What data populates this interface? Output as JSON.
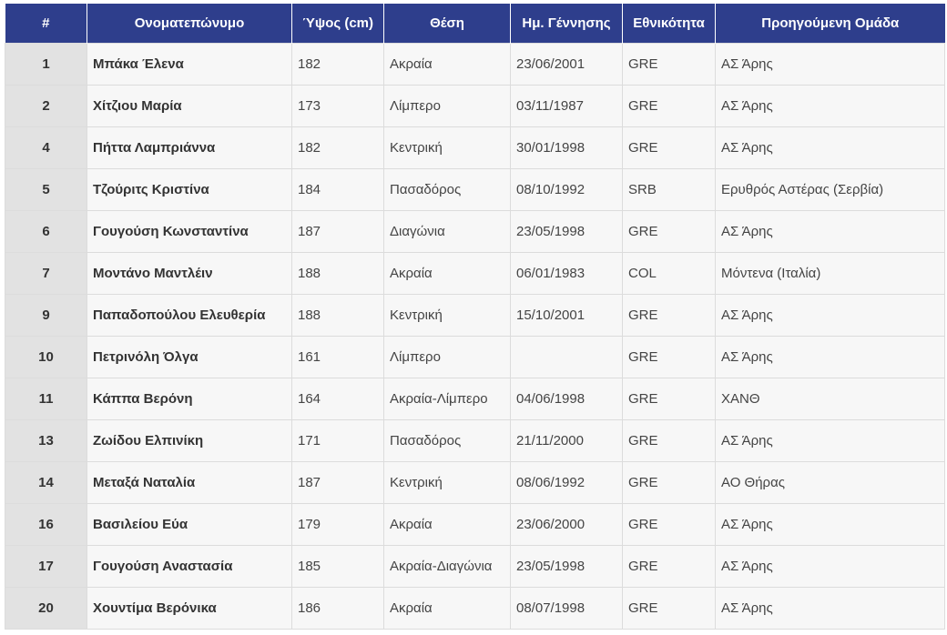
{
  "table": {
    "headers": {
      "num": "#",
      "name": "Ονοματεπώνυμο",
      "height": "Ύψος (cm)",
      "position": "Θέση",
      "dob": "Ημ. Γέννησης",
      "nationality": "Εθνικότητα",
      "previous_team": "Προηγούμενη Ομάδα"
    },
    "rows": [
      {
        "num": "1",
        "name": "Μπάκα Έλενα",
        "height": "182",
        "position": "Ακραία",
        "dob": "23/06/2001",
        "nationality": "GRE",
        "previous_team": "ΑΣ Άρης"
      },
      {
        "num": "2",
        "name": "Χίτζιου Μαρία",
        "height": "173",
        "position": "Λίμπερο",
        "dob": "03/11/1987",
        "nationality": "GRE",
        "previous_team": "ΑΣ Άρης"
      },
      {
        "num": "4",
        "name": "Πήττα Λαμπριάννα",
        "height": "182",
        "position": "Κεντρική",
        "dob": "30/01/1998",
        "nationality": "GRE",
        "previous_team": "ΑΣ Άρης"
      },
      {
        "num": "5",
        "name": "Τζούριτς Κριστίνα",
        "height": "184",
        "position": "Πασαδόρος",
        "dob": "08/10/1992",
        "nationality": "SRB",
        "previous_team": "Ερυθρός Αστέρας (Σερβία)"
      },
      {
        "num": "6",
        "name": "Γουγούση Κωνσταντίνα",
        "height": "187",
        "position": "Διαγώνια",
        "dob": "23/05/1998",
        "nationality": "GRE",
        "previous_team": "ΑΣ Άρης"
      },
      {
        "num": "7",
        "name": "Μοντάνο Μαντλέιν",
        "height": "188",
        "position": "Ακραία",
        "dob": "06/01/1983",
        "nationality": "COL",
        "previous_team": "Μόντενα (Ιταλία)"
      },
      {
        "num": "9",
        "name": "Παπαδοπούλου Ελευθερία",
        "height": "188",
        "position": "Κεντρική",
        "dob": "15/10/2001",
        "nationality": "GRE",
        "previous_team": "ΑΣ Άρης"
      },
      {
        "num": "10",
        "name": "Πετρινόλη Όλγα",
        "height": "161",
        "position": "Λίμπερο",
        "dob": "",
        "nationality": "GRE",
        "previous_team": "ΑΣ Άρης"
      },
      {
        "num": "11",
        "name": "Κάππα Βερόνη",
        "height": "164",
        "position": "Ακραία-Λίμπερο",
        "dob": "04/06/1998",
        "nationality": "GRE",
        "previous_team": "ΧΑΝΘ"
      },
      {
        "num": "13",
        "name": "Ζωίδου Ελπινίκη",
        "height": "171",
        "position": "Πασαδόρος",
        "dob": "21/11/2000",
        "nationality": "GRE",
        "previous_team": "ΑΣ Άρης"
      },
      {
        "num": "14",
        "name": "Μεταξά Ναταλία",
        "height": "187",
        "position": "Κεντρική",
        "dob": "08/06/1992",
        "nationality": "GRE",
        "previous_team": "ΑΟ Θήρας"
      },
      {
        "num": "16",
        "name": "Βασιλείου Εύα",
        "height": "179",
        "position": "Ακραία",
        "dob": "23/06/2000",
        "nationality": "GRE",
        "previous_team": "ΑΣ Άρης"
      },
      {
        "num": "17",
        "name": "Γουγούση Αναστασία",
        "height": "185",
        "position": "Ακραία-Διαγώνια",
        "dob": "23/05/1998",
        "nationality": "GRE",
        "previous_team": "ΑΣ Άρης"
      },
      {
        "num": "20",
        "name": "Χουντίμα Βερόνικα",
        "height": "186",
        "position": "Ακραία",
        "dob": "08/07/1998",
        "nationality": "GRE",
        "previous_team": "ΑΣ Άρης"
      }
    ]
  },
  "colors": {
    "header_bg": "#2e3e8c",
    "header_text": "#ffffff",
    "row_bg": "#f7f7f7",
    "num_col_bg": "#e2e2e2"
  }
}
